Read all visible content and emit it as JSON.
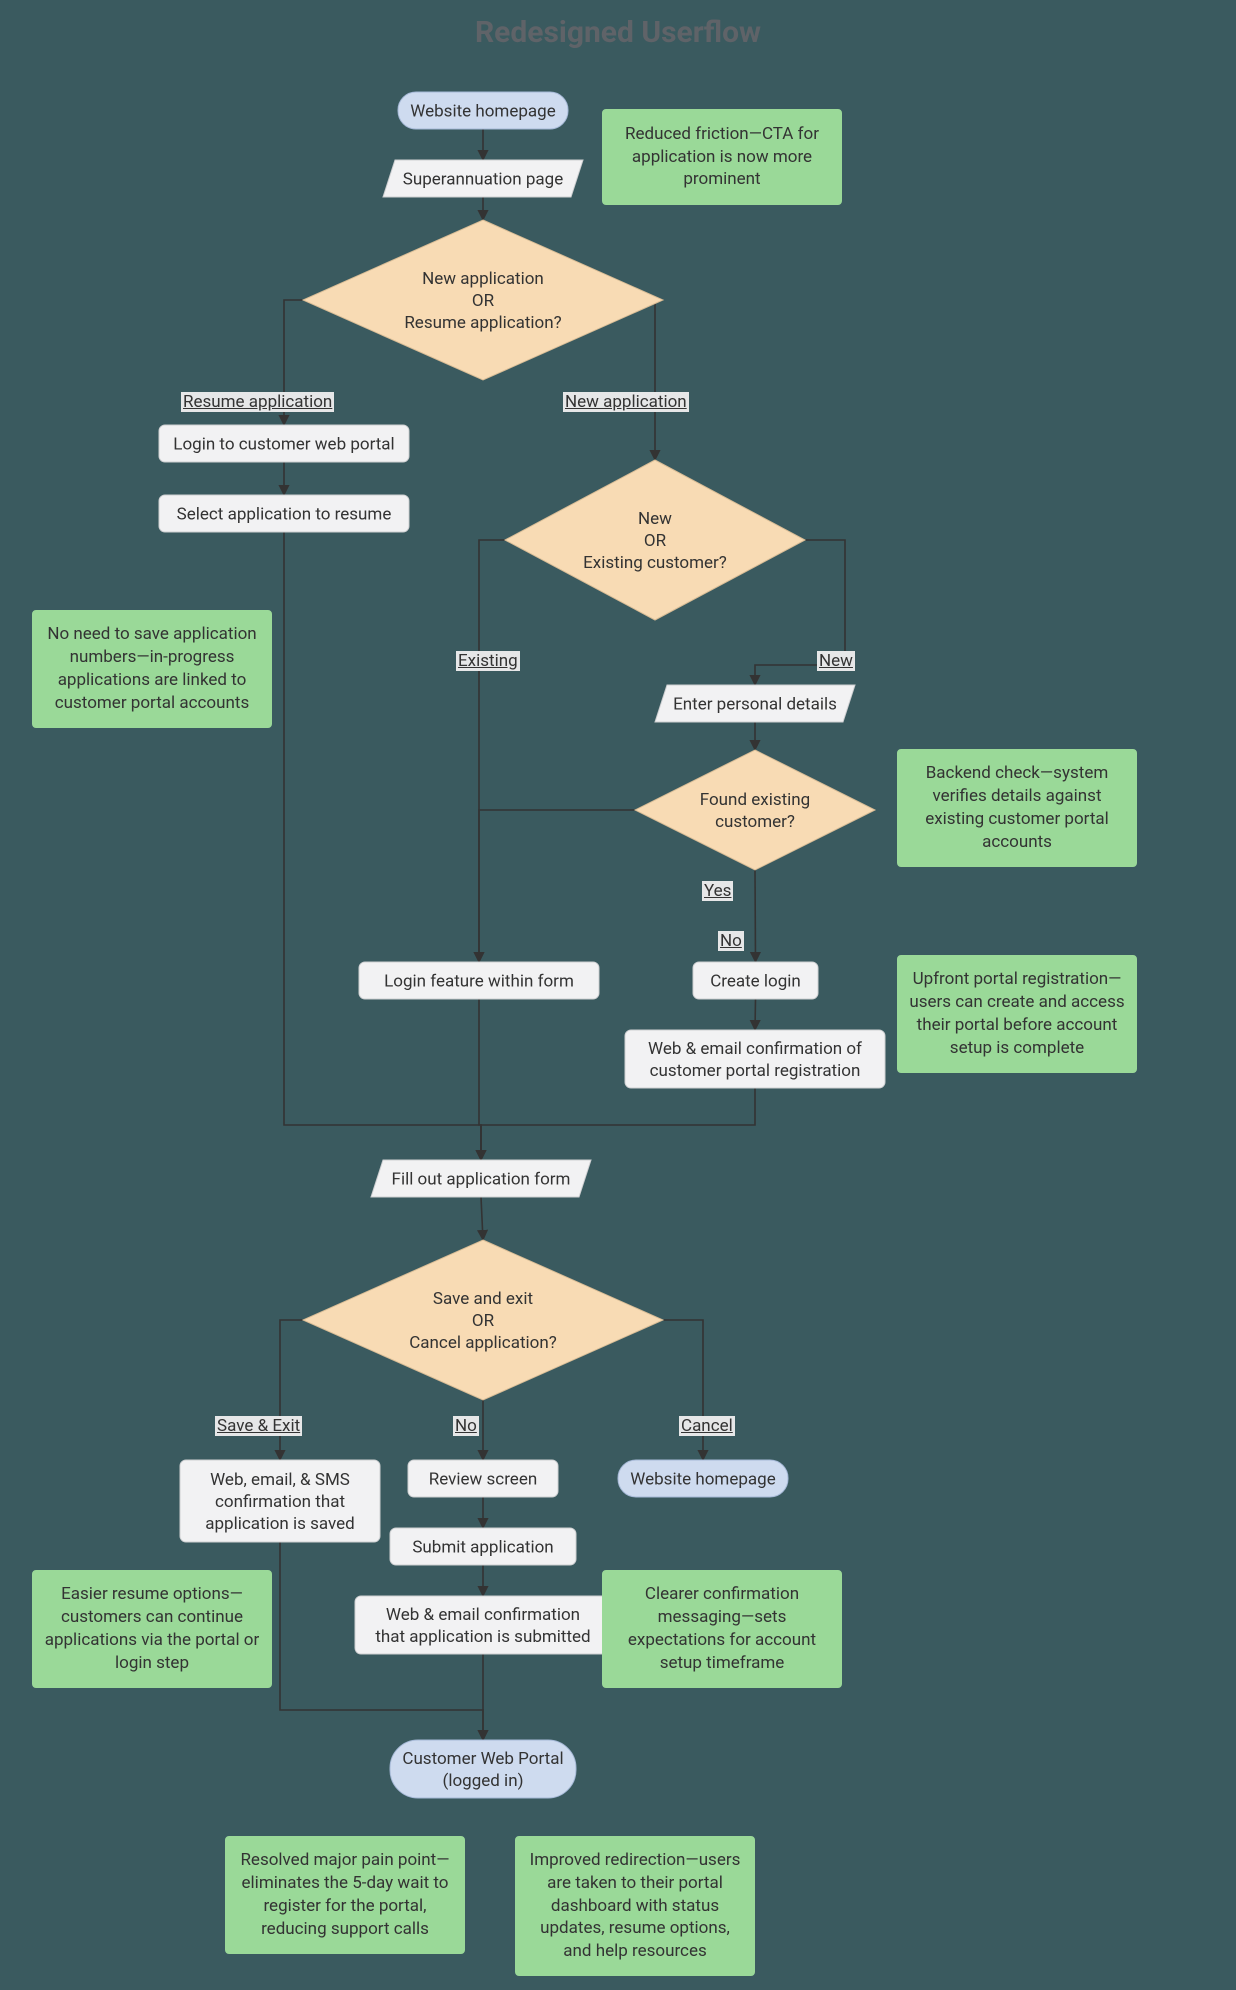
{
  "title": "Redesigned Userflow",
  "nodes": {
    "homepage": {
      "label": "Website homepage"
    },
    "super_page": {
      "label": "Superannuation page"
    },
    "decision_new_resume": {
      "lines": [
        "New application",
        "OR",
        "Resume application?"
      ]
    },
    "login_portal": {
      "label": "Login to customer web portal"
    },
    "select_resume": {
      "label": "Select application to resume"
    },
    "decision_new_existing": {
      "lines": [
        "New",
        "OR",
        "Existing customer?"
      ]
    },
    "enter_details": {
      "label": "Enter personal details"
    },
    "decision_found": {
      "lines": [
        "Found existing",
        "customer?"
      ]
    },
    "login_in_form": {
      "label": "Login feature within form"
    },
    "create_login": {
      "label": "Create login"
    },
    "email_conf_reg": {
      "lines": [
        "Web & email confirmation of",
        "customer portal registration"
      ]
    },
    "fill_form": {
      "label": "Fill out application form"
    },
    "decision_saveexit": {
      "lines": [
        "Save and exit",
        "OR",
        "Cancel application?"
      ]
    },
    "save_conf": {
      "lines": [
        "Web, email, & SMS",
        "confirmation that",
        "application is saved"
      ]
    },
    "review": {
      "label": "Review screen"
    },
    "submit": {
      "label": "Submit application"
    },
    "submit_conf": {
      "lines": [
        "Web & email confirmation",
        "that application is submitted"
      ]
    },
    "homepage2": {
      "label": "Website homepage"
    },
    "portal_logged": {
      "lines": [
        "Customer Web Portal",
        "(logged in)"
      ]
    }
  },
  "edges": {
    "resume_app": "Resume application",
    "new_app": "New application",
    "existing": "Existing",
    "new": "New",
    "yes": "Yes",
    "no_found": "No",
    "save_exit": "Save & Exit",
    "no_saveexit": "No",
    "cancel": "Cancel"
  },
  "notes": {
    "n1": "Reduced friction—CTA for application is now more prominent",
    "n2": "No need to save application numbers—in-progress applications are linked to customer portal accounts",
    "n3": "Backend check—system verifies details against existing customer portal accounts",
    "n4": "Upfront portal registration—users can create and access their portal before account setup is complete",
    "n5": "Easier resume options—customers can continue applications via the portal or login step",
    "n6": "Clearer confirmation messaging—sets expectations for account setup timeframe",
    "n7": "Resolved major pain point—eliminates the 5-day wait to register for the portal, reducing support calls",
    "n8": "Improved redirection—users are taken to their portal dashboard with status updates, resume options, and help resources"
  },
  "colors": {
    "bg": "#3a5a5f",
    "process_fill": "#f2f2f3",
    "process_stroke": "#cfd0d2",
    "terminator_fill": "#cedbef",
    "terminator_stroke": "#a6b9d7",
    "decision_fill": "#f8dbb4",
    "decision_stroke": "#d9bd96",
    "note_fill": "#9ad998",
    "edge": "#333333"
  }
}
